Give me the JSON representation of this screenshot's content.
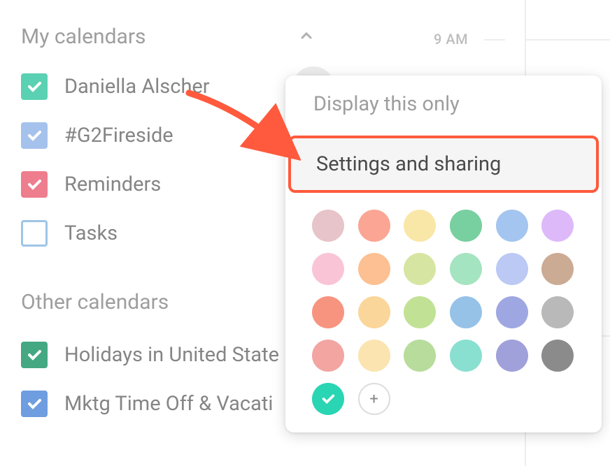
{
  "timeline": {
    "label_9am": "9 AM"
  },
  "sidebar": {
    "my_calendars_title": "My calendars",
    "other_calendars_title": "Other calendars",
    "calendars": [
      {
        "label": "Daniella Alscher",
        "color": "#5ad1b2",
        "checked": true
      },
      {
        "label": "#G2Fireside",
        "color": "#a4c2ec",
        "checked": true
      },
      {
        "label": "Reminders",
        "color": "#ee7d8e",
        "checked": true
      },
      {
        "label": "Tasks",
        "color": "#9ec5e6",
        "checked": false
      }
    ],
    "other": [
      {
        "label": "Holidays in United State",
        "color": "#44a882",
        "checked": true
      },
      {
        "label": "Mktg Time Off & Vacati",
        "color": "#6e9ee0",
        "checked": true
      }
    ]
  },
  "popup": {
    "display_only": "Display this only",
    "settings_sharing": "Settings and sharing",
    "colors": [
      "#e7c4c9",
      "#fba594",
      "#f9e7a8",
      "#78cf9f",
      "#a3c5ef",
      "#ddb9fa",
      "#fac4d7",
      "#fdc092",
      "#d6e6a2",
      "#a5e4c1",
      "#bbc9f4",
      "#cbab94",
      "#f79480",
      "#fad69a",
      "#c1e295",
      "#96c2e8",
      "#9fa7e2",
      "#b9b9b9",
      "#f2a5a1",
      "#fbe4b0",
      "#b7dc9c",
      "#89e0d0",
      "#a0a0db",
      "#8b8b8b",
      "#29d5b3"
    ],
    "add_label": "+"
  }
}
